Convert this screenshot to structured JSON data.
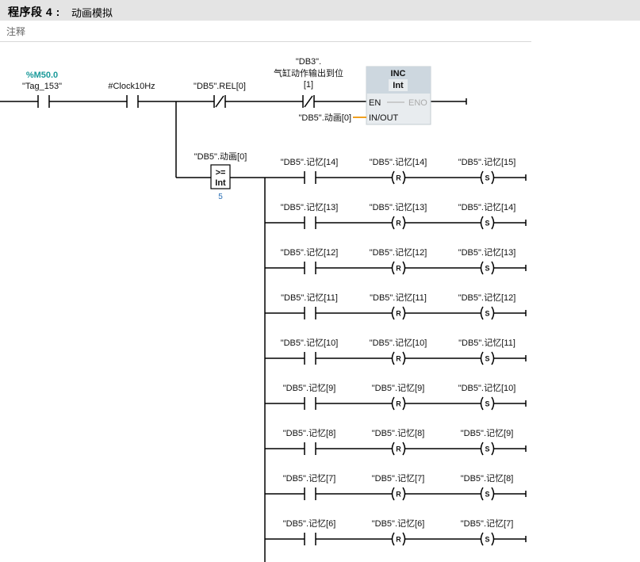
{
  "network": {
    "label": "程序段 4 :",
    "title": "动画模拟",
    "comment": "注释"
  },
  "top_row": {
    "contact1": {
      "address": "%M50.0",
      "tag": "\"Tag_153\"",
      "type": "NO"
    },
    "contact2": {
      "tag": "#Clock10Hz",
      "type": "NO"
    },
    "contact3": {
      "tag": "\"DB5\".REL[0]",
      "type": "NC"
    },
    "contact4": {
      "tag_line1": "\"DB3\".",
      "tag_line2": "气缸动作输出到位",
      "tag_line3": "[1]",
      "type": "NC"
    },
    "inc_block": {
      "name": "INC",
      "dtype": "Int",
      "en": "EN",
      "eno": "ENO",
      "inout_pin": "IN/OUT",
      "inout_value": "\"DB5\".动画[0]"
    }
  },
  "compare": {
    "operand": "\"DB5\".动画[0]",
    "op": ">=",
    "dtype": "Int",
    "value": "5"
  },
  "rungs": [
    {
      "contact": "\"DB5\".记忆[14]",
      "reset": "\"DB5\".记忆[14]",
      "set": "\"DB5\".记忆[15]"
    },
    {
      "contact": "\"DB5\".记忆[13]",
      "reset": "\"DB5\".记忆[13]",
      "set": "\"DB5\".记忆[14]"
    },
    {
      "contact": "\"DB5\".记忆[12]",
      "reset": "\"DB5\".记忆[12]",
      "set": "\"DB5\".记忆[13]"
    },
    {
      "contact": "\"DB5\".记忆[11]",
      "reset": "\"DB5\".记忆[11]",
      "set": "\"DB5\".记忆[12]"
    },
    {
      "contact": "\"DB5\".记忆[10]",
      "reset": "\"DB5\".记忆[10]",
      "set": "\"DB5\".记忆[11]"
    },
    {
      "contact": "\"DB5\".记忆[9]",
      "reset": "\"DB5\".记忆[9]",
      "set": "\"DB5\".记忆[10]"
    },
    {
      "contact": "\"DB5\".记忆[8]",
      "reset": "\"DB5\".记忆[8]",
      "set": "\"DB5\".记忆[9]"
    },
    {
      "contact": "\"DB5\".记忆[7]",
      "reset": "\"DB5\".记忆[7]",
      "set": "\"DB5\".记忆[8]"
    },
    {
      "contact": "\"DB5\".记忆[6]",
      "reset": "\"DB5\".记忆[6]",
      "set": "\"DB5\".记忆[7]"
    }
  ],
  "coil_letters": {
    "reset": "R",
    "set": "S"
  },
  "colors": {
    "header_bg": "#e4e4e4",
    "address": "#1a9a9a",
    "value": "#2a6fb5",
    "block_bg": "#e8ecef",
    "block_title_bg": "#cdd7df",
    "inout_wire": "#f0a020"
  }
}
